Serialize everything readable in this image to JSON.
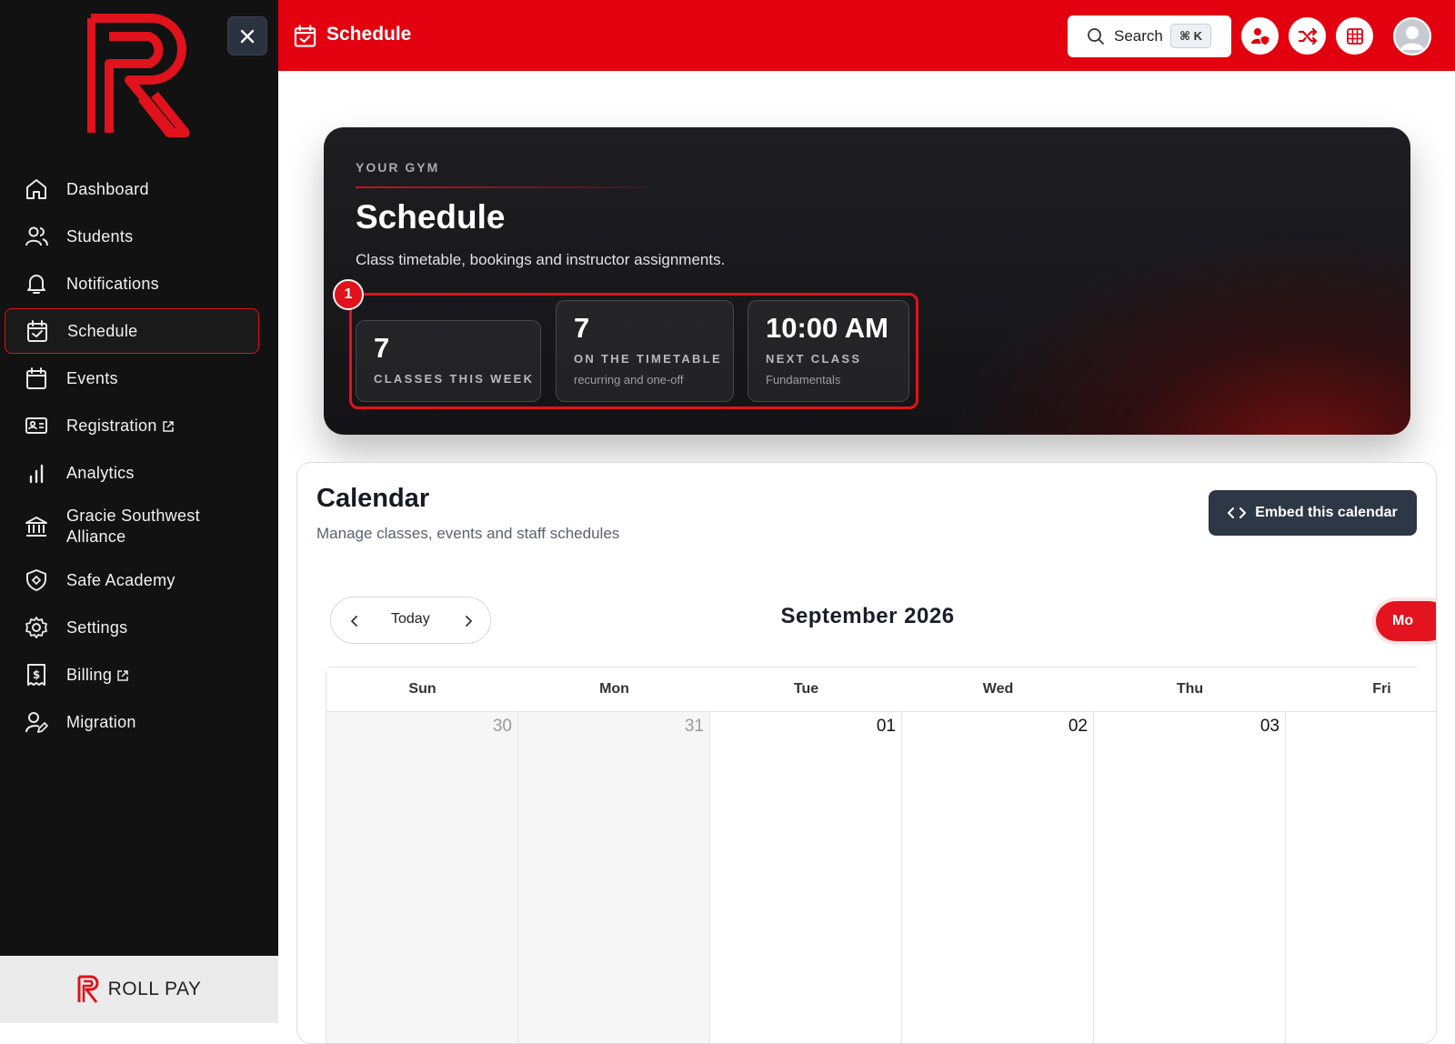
{
  "sidebar": {
    "close_icon": "close-icon",
    "items": [
      {
        "label": "Dashboard",
        "icon": "home-icon"
      },
      {
        "label": "Students",
        "icon": "users-icon"
      },
      {
        "label": "Notifications",
        "icon": "bell-icon"
      },
      {
        "label": "Schedule",
        "icon": "calendar-check-icon",
        "active": true
      },
      {
        "label": "Events",
        "icon": "calendar-icon"
      },
      {
        "label": "Registration",
        "icon": "id-card-icon",
        "external": true
      },
      {
        "label": "Analytics",
        "icon": "bar-chart-icon"
      },
      {
        "label": "Gracie Southwest Alliance",
        "icon": "bank-icon"
      },
      {
        "label": "Safe Academy",
        "icon": "shield-icon"
      },
      {
        "label": "Settings",
        "icon": "gear-icon"
      },
      {
        "label": "Billing",
        "icon": "billing-icon",
        "external": true
      },
      {
        "label": "Migration",
        "icon": "user-edit-icon"
      }
    ],
    "footer_brand": "ROLL PAY"
  },
  "topbar": {
    "title": "Schedule",
    "search_label": "Search",
    "search_shortcut": "⌘ K",
    "icons": [
      "user-shield-icon",
      "shuffle-icon",
      "grid-icon",
      "avatar"
    ]
  },
  "hero": {
    "eyebrow": "YOUR GYM",
    "title": "Schedule",
    "subtitle": "Class timetable, bookings and instructor assignments.",
    "highlight_badge": "1",
    "stats": [
      {
        "value": "7",
        "label": "CLASSES THIS WEEK",
        "sub": ""
      },
      {
        "value": "7",
        "label": "ON THE TIMETABLE",
        "sub": "recurring and one-off"
      },
      {
        "value": "10:00 AM",
        "label": "NEXT CLASS",
        "sub": "Fundamentals"
      }
    ]
  },
  "calendar": {
    "title": "Calendar",
    "subtitle": "Manage classes, events and staff schedules",
    "embed_label": "Embed this calendar",
    "today_label": "Today",
    "month_label": "September 2026",
    "view_label": "Mo",
    "days": [
      {
        "name": "Sun",
        "date": "30",
        "in_month": false
      },
      {
        "name": "Mon",
        "date": "31",
        "in_month": false
      },
      {
        "name": "Tue",
        "date": "01",
        "in_month": true
      },
      {
        "name": "Wed",
        "date": "02",
        "in_month": true
      },
      {
        "name": "Thu",
        "date": "03",
        "in_month": true
      },
      {
        "name": "Fri",
        "date": "",
        "in_month": true
      }
    ]
  },
  "colors": {
    "brand_red": "#e3000f",
    "sidebar_bg": "#121212",
    "hero_bg": "#17171a",
    "embed_btn": "#2e3746"
  }
}
